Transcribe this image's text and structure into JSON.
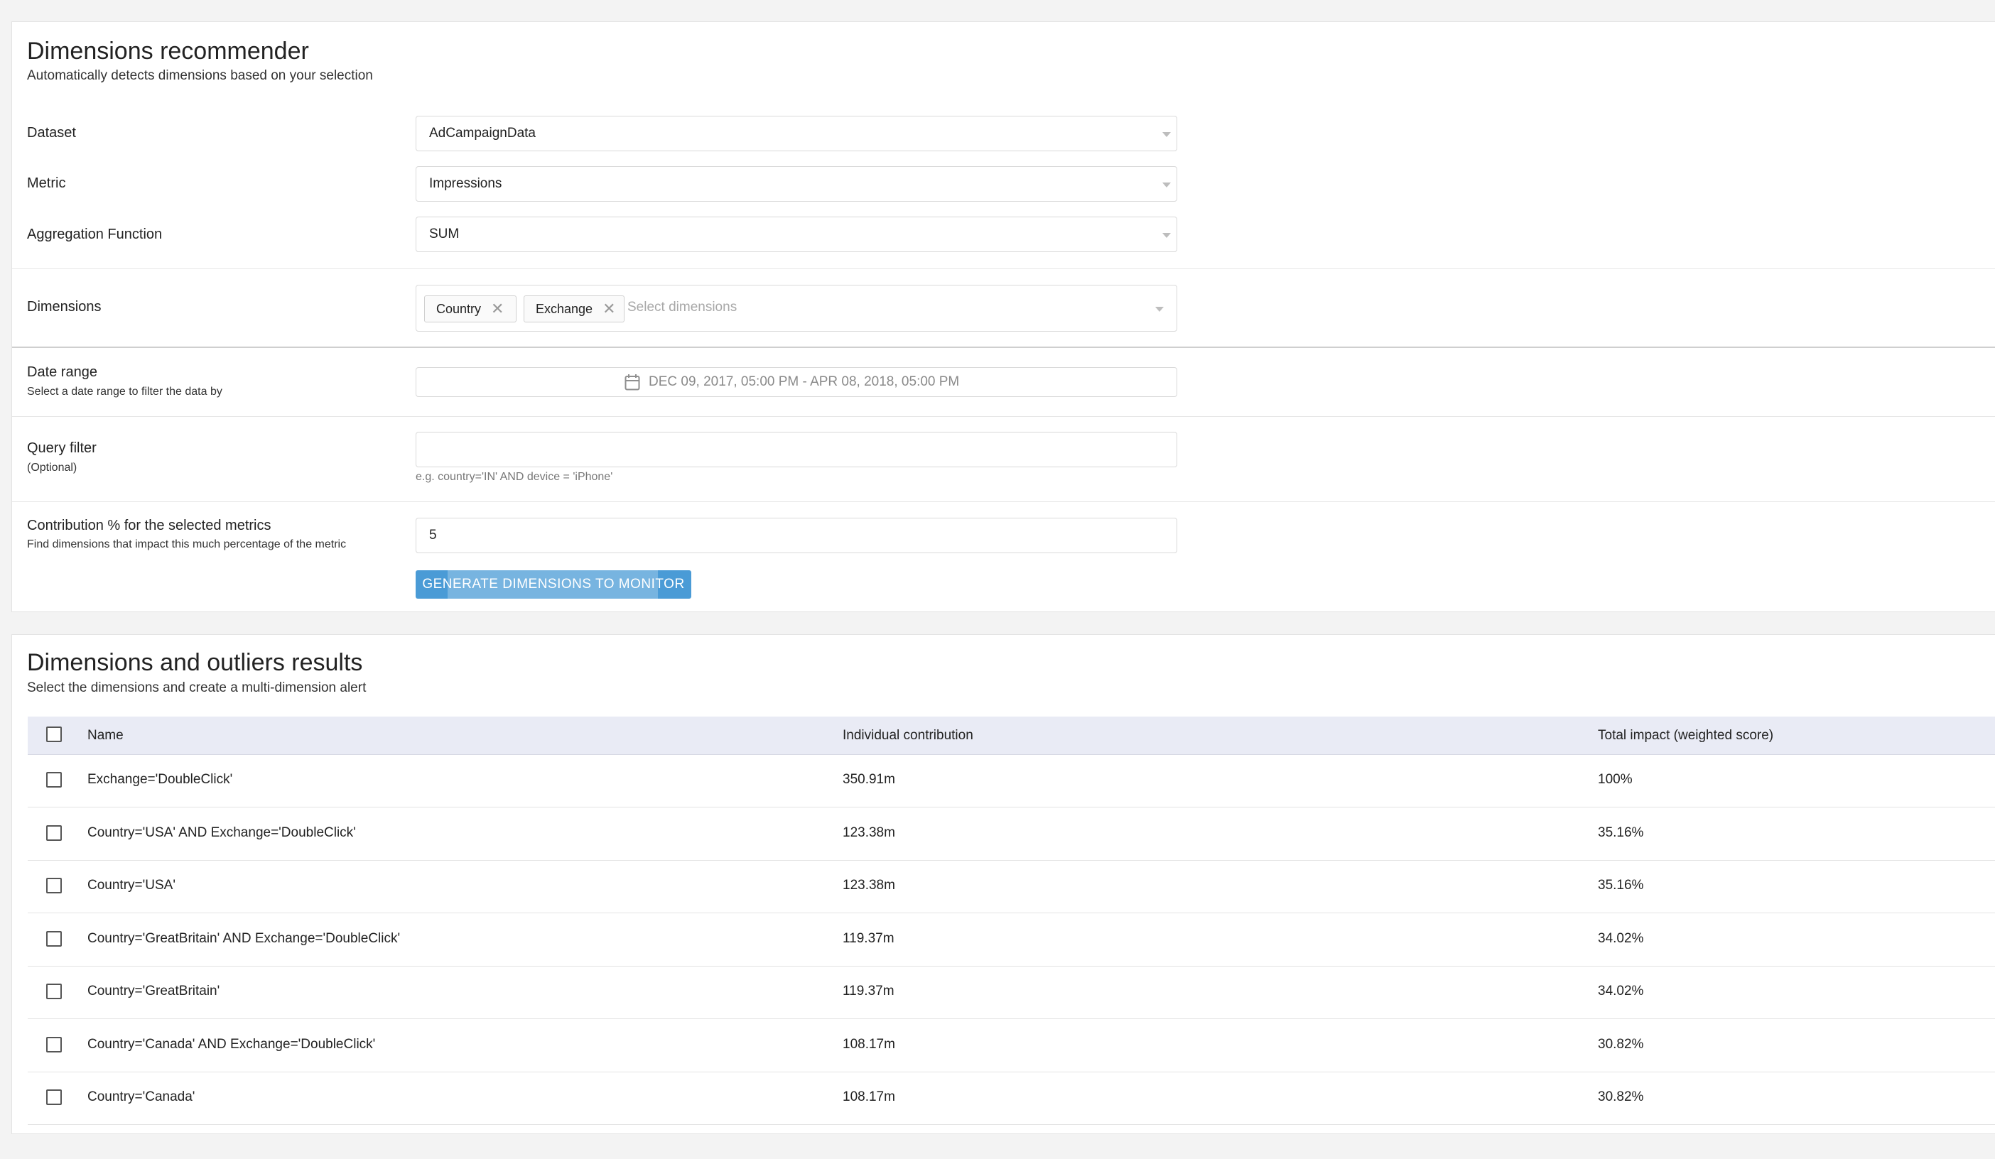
{
  "recommender": {
    "title": "Dimensions recommender",
    "subtitle": "Automatically detects dimensions based on your selection",
    "dataset": {
      "label": "Dataset",
      "value": "AdCampaignData"
    },
    "metric": {
      "label": "Metric",
      "value": "Impressions"
    },
    "aggregation": {
      "label": "Aggregation Function",
      "value": "SUM"
    },
    "dimensions": {
      "label": "Dimensions",
      "chips": [
        "Country",
        "Exchange"
      ],
      "placeholder": "Select dimensions"
    },
    "date_range": {
      "label": "Date range",
      "help": "Select a date range to filter the data by",
      "value": "DEC 09, 2017, 05:00 PM - APR 08, 2018, 05:00 PM"
    },
    "query_filter": {
      "label": "Query filter",
      "help": "(Optional)",
      "value": "",
      "hint": "e.g. country='IN' AND device = 'iPhone'"
    },
    "contribution": {
      "label": "Contribution % for the selected metrics",
      "help": "Find dimensions that impact this much percentage of the metric",
      "value": "5"
    },
    "generate_button": "GENERATE DIMENSIONS TO MONITOR"
  },
  "results": {
    "title": "Dimensions and outliers results",
    "subtitle": "Select the dimensions and create a multi-dimension alert",
    "columns": [
      "Name",
      "Individual contribution",
      "Total impact (weighted score)"
    ],
    "rows": [
      {
        "name": "Exchange='DoubleClick'",
        "contribution": "350.91m",
        "impact": "100%"
      },
      {
        "name": "Country='USA' AND Exchange='DoubleClick'",
        "contribution": "123.38m",
        "impact": "35.16%"
      },
      {
        "name": "Country='USA'",
        "contribution": "123.38m",
        "impact": "35.16%"
      },
      {
        "name": "Country='GreatBritain' AND Exchange='DoubleClick'",
        "contribution": "119.37m",
        "impact": "34.02%"
      },
      {
        "name": "Country='GreatBritain'",
        "contribution": "119.37m",
        "impact": "34.02%"
      },
      {
        "name": "Country='Canada' AND Exchange='DoubleClick'",
        "contribution": "108.17m",
        "impact": "30.82%"
      },
      {
        "name": "Country='Canada'",
        "contribution": "108.17m",
        "impact": "30.82%"
      }
    ]
  }
}
